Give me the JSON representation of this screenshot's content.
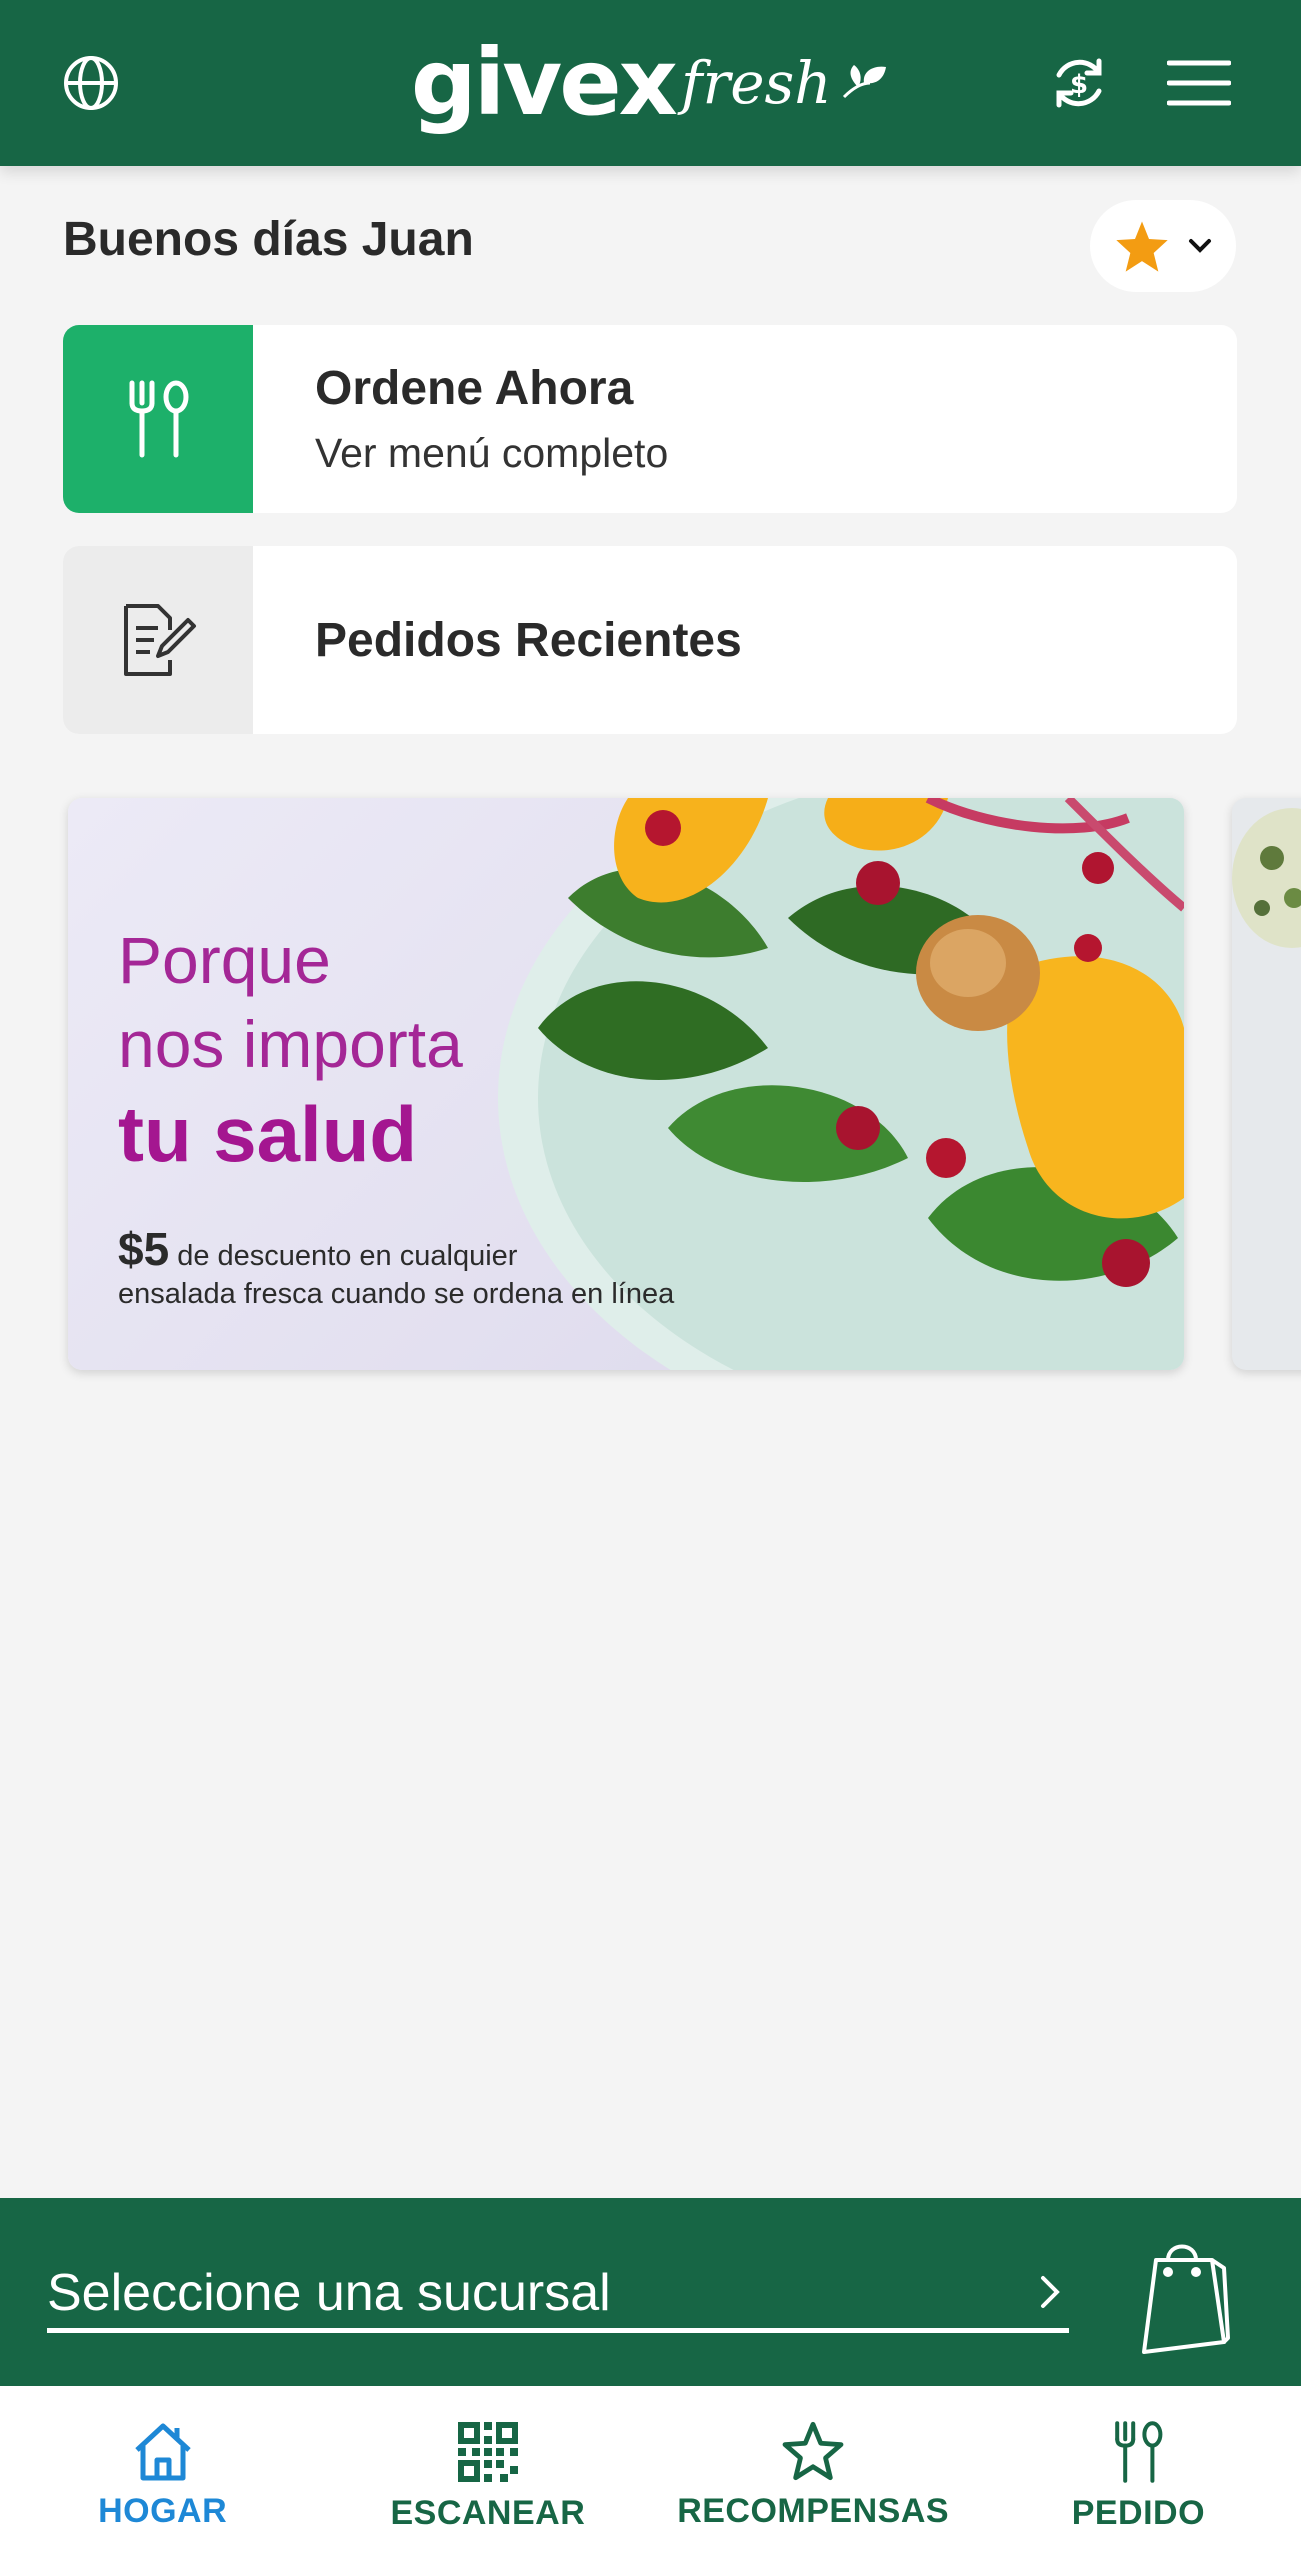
{
  "header": {
    "logo_main": "givex",
    "logo_sub": "fresh",
    "icons": [
      "globe-icon",
      "currency-exchange-icon",
      "menu-icon"
    ]
  },
  "greeting": "Buenos días Juan",
  "favorites": {
    "icon": "star-icon",
    "chevron": "chevron-down-icon"
  },
  "cards": [
    {
      "title": "Ordene Ahora",
      "subtitle": "Ver menú completo",
      "icon": "fork-spoon-icon",
      "accent": "#1db06a"
    },
    {
      "title": "Pedidos Recientes",
      "icon": "document-edit-icon"
    }
  ],
  "banner": {
    "line1": "Porque",
    "line2": "nos importa",
    "line3": "tu salud",
    "amount": "$5",
    "promo_a": "de descuento en cualquier",
    "promo_b": "ensalada fresca cuando se ordena en línea"
  },
  "branch": {
    "placeholder": "Seleccione una sucursal",
    "bag_icon": "shopping-bag-icon"
  },
  "nav": {
    "items": [
      {
        "label": "HOGAR",
        "icon": "home-icon",
        "active": true
      },
      {
        "label": "ESCANEAR",
        "icon": "qr-code-icon",
        "active": false
      },
      {
        "label": "RECOMPENSAS",
        "icon": "star-outline-icon",
        "active": false
      },
      {
        "label": "PEDIDO",
        "icon": "fork-spoon-icon",
        "active": false
      }
    ]
  },
  "colors": {
    "brand_green": "#176645",
    "accent_green": "#1db06a",
    "nav_active": "#1e88d6",
    "star": "#f39c12",
    "promo_purple": "#a42796"
  }
}
